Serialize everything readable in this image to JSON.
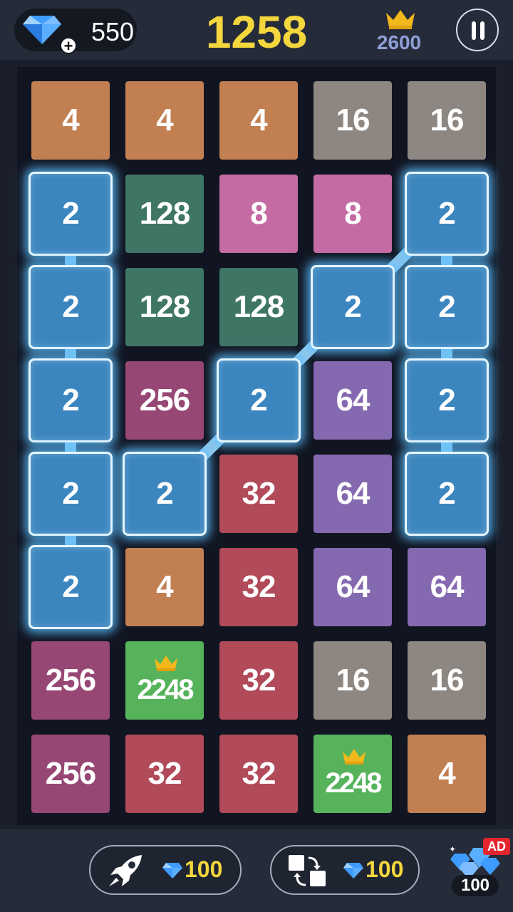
{
  "header": {
    "gems": "550",
    "gem_add_glyph": "+",
    "score": "1258",
    "best_score": "2600",
    "icons": [
      "gem-icon",
      "plus-icon",
      "crown-icon",
      "pause-icon"
    ]
  },
  "board": {
    "columns": 5,
    "rows": 8,
    "grid": [
      [
        "4",
        "4",
        "4",
        "16",
        "16"
      ],
      [
        "2",
        "128",
        "8",
        "8",
        "2"
      ],
      [
        "2",
        "128",
        "128",
        "2",
        "2"
      ],
      [
        "2",
        "256",
        "2",
        "64",
        "2"
      ],
      [
        "2",
        "2",
        "32",
        "64",
        "2"
      ],
      [
        "2",
        "4",
        "32",
        "64",
        "64"
      ],
      [
        "256",
        "2248",
        "32",
        "16",
        "16"
      ],
      [
        "256",
        "32",
        "32",
        "2248",
        "4"
      ]
    ],
    "crowned_values": [
      "2248"
    ],
    "selected_chain": [
      [
        5,
        0
      ],
      [
        4,
        0
      ],
      [
        3,
        0
      ],
      [
        2,
        0
      ],
      [
        1,
        0
      ],
      [
        4,
        1
      ],
      [
        3,
        2
      ],
      [
        2,
        3
      ],
      [
        1,
        4
      ],
      [
        2,
        4
      ],
      [
        3,
        4
      ],
      [
        4,
        4
      ]
    ],
    "tile_colors": {
      "2": "#3b86bf",
      "4": "#c17f52",
      "8": "#c56ba3",
      "16": "#8e8781",
      "32": "#b14a59",
      "64": "#8569b0",
      "128": "#3f7565",
      "256": "#974773",
      "2248": "#56b35c"
    }
  },
  "footer": {
    "rocket_cost": "100",
    "swap_cost": "100",
    "ad_badge": "AD",
    "ad_reward": "100",
    "icons": [
      "rocket-icon",
      "swap-icon",
      "gem-icon",
      "gem-pile-icon"
    ]
  }
}
